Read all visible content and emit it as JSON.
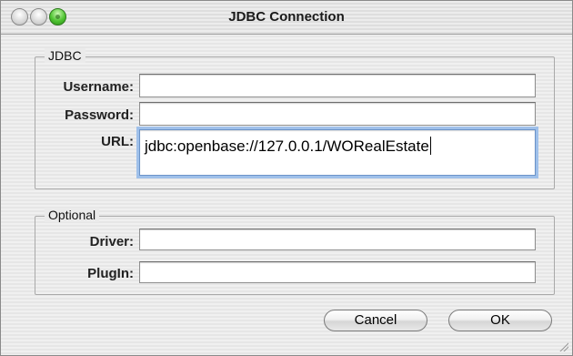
{
  "window": {
    "title": "JDBC Connection"
  },
  "jdbc_group": {
    "legend": "JDBC",
    "username": {
      "label": "Username:",
      "value": ""
    },
    "password": {
      "label": "Password:",
      "value": ""
    },
    "url": {
      "label": "URL:",
      "value": "jdbc:openbase://127.0.0.1/WORealEstate"
    }
  },
  "optional_group": {
    "legend": "Optional",
    "driver": {
      "label": "Driver:",
      "value": ""
    },
    "plugin": {
      "label": "PlugIn:",
      "value": ""
    }
  },
  "buttons": {
    "cancel": "Cancel",
    "ok": "OK"
  },
  "colors": {
    "zoom_button": "#4ec431",
    "focus_ring": "#9fc0ea"
  },
  "icons": [
    "close-icon",
    "minimize-icon",
    "zoom-icon",
    "resize-grip-icon"
  ]
}
